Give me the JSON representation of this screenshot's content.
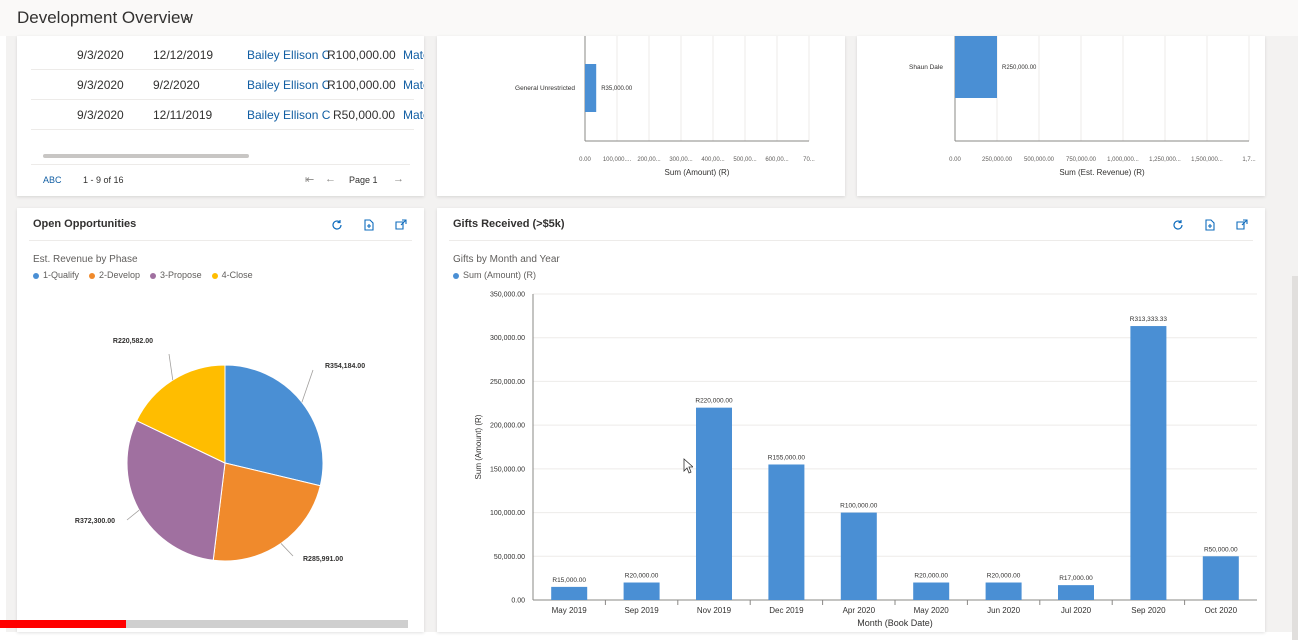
{
  "header": {
    "title": "Development Overview",
    "chevron_icon": "chevron-down-icon"
  },
  "grid": {
    "rows": [
      {
        "date1": "9/3/2020",
        "date2": "12/12/2019",
        "owner": "Bailey Ellison C",
        "amount": "R100,000.00",
        "more": "Mater"
      },
      {
        "date1": "9/3/2020",
        "date2": "9/2/2020",
        "owner": "Bailey Ellison C",
        "amount": "R100,000.00",
        "more": "Mater"
      },
      {
        "date1": "9/3/2020",
        "date2": "12/11/2019",
        "owner": "Bailey Ellison C",
        "amount": "R50,000.00",
        "more": "Mater"
      }
    ],
    "footer": {
      "abc": "ABC",
      "range": "1 - 9 of 16",
      "page": "Page 1"
    }
  },
  "chart_top_mid": {
    "chart_data": {
      "type": "bar",
      "orientation": "horizontal",
      "categories": [
        "General Unrestricted"
      ],
      "values": [
        35000
      ],
      "data_labels": [
        "R35,000.00"
      ],
      "xlabel": "Sum (Amount) (R)",
      "tick_labels": [
        "0.00",
        "100,000....",
        "200,00...",
        "300,00...",
        "400,00...",
        "500,00...",
        "600,00...",
        "70..."
      ],
      "xlim": [
        0,
        700000
      ],
      "grid": true
    }
  },
  "chart_top_right": {
    "chart_data": {
      "type": "bar",
      "orientation": "horizontal",
      "categories": [
        "Shaun Dale"
      ],
      "values": [
        250000
      ],
      "data_labels": [
        "R250,000.00"
      ],
      "xlabel": "Sum (Est. Revenue) (R)",
      "tick_labels": [
        "0.00",
        "250,000.00",
        "500,000.00",
        "750,000.00",
        "1,000,000...",
        "1,250,000...",
        "1,500,000...",
        "1,7..."
      ],
      "xlim": [
        0,
        1750000
      ],
      "grid": true
    }
  },
  "open_opps": {
    "title": "Open Opportunities",
    "subtitle": "Est. Revenue by Phase",
    "chart_data": {
      "type": "pie",
      "categories": [
        "1-Qualify",
        "2-Develop",
        "3-Propose",
        "4-Close"
      ],
      "values": [
        354184,
        285991,
        372300,
        220582
      ],
      "data_labels": [
        "R354,184.00",
        "R285,991.00",
        "R372,300.00",
        "R220,582.00"
      ],
      "colors": [
        "#4a8fd4",
        "#f08a2c",
        "#a070a0",
        "#ffbd00"
      ],
      "legend": "top-left"
    }
  },
  "gifts": {
    "title": "Gifts Received (>$5k)",
    "subtitle": "Gifts by Month and Year",
    "chart_data": {
      "type": "bar",
      "categories": [
        "May 2019",
        "Sep 2019",
        "Nov 2019",
        "Dec 2019",
        "Apr 2020",
        "May 2020",
        "Jun 2020",
        "Jul 2020",
        "Sep 2020",
        "Oct 2020"
      ],
      "series": [
        {
          "name": "Sum (Amount) (R)",
          "values": [
            15000,
            20000,
            220000,
            155000,
            100000,
            20000,
            20000,
            17000,
            313333.33,
            50000
          ]
        }
      ],
      "data_labels": [
        "R15,000.00",
        "R20,000.00",
        "R220,000.00",
        "R155,000.00",
        "R100,000.00",
        "R20,000.00",
        "R20,000.00",
        "R17,000.00",
        "R313,333.33",
        "R50,000.00"
      ],
      "y_tick_labels": [
        "0.00",
        "50,000.00",
        "100,000.00",
        "150,000.00",
        "200,000.00",
        "250,000.00",
        "300,000.00",
        "350,000.00"
      ],
      "ylim": [
        0,
        350000
      ],
      "xlabel": "Month (Book Date)",
      "ylabel": "Sum (Amount) (R)",
      "color": "#4a8fd4",
      "legend": "top-left",
      "grid": true
    }
  },
  "icons": {
    "refresh": "refresh-icon",
    "export": "export-icon",
    "expand": "expand-icon"
  },
  "video_progress": 0.31
}
